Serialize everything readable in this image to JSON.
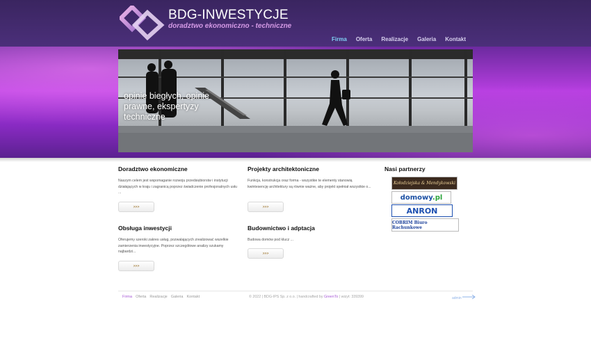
{
  "header": {
    "title": "BDG-INWESTYCJE",
    "subtitle": "doradztwo ekonomiczno - techniczne",
    "nav": [
      "Firma",
      "Oferta",
      "Realizacje",
      "Galeria",
      "Kontakt"
    ]
  },
  "hero": {
    "caption": "opinie biegłych, opinie prawne, ekspertyzy techniczne"
  },
  "sections": [
    {
      "title": "Doradztwo ekonomiczne",
      "text": "Naszym celem jest wspomaganie rozwoju przedsiębiorstw i instytucji działających w kraju i zagranicą poprzez świadczenie profesjonalnych usłu ...",
      "button": ">>>"
    },
    {
      "title": "Projekty architektoniczne",
      "text": "Funkcja, konstrukcja oraz forma - wszystkie te elementy stanowią kwintesencję architektury są równie ważne, aby projekt spełniał wszystkie o...",
      "button": ">>>"
    },
    {
      "title": "Obsługa inwestycji",
      "text": "Oferujemy szeroki zakres usług, pozwalających zrealizować wszelkie zamierzenia inwestycyjne. Poprzez szczegółowe analizy szukamy najbardzi...",
      "button": ">>>"
    },
    {
      "title": "Budownictwo i adptacja",
      "text": "Budowa domów pod klucz ...",
      "button": ">>>"
    }
  ],
  "partners": {
    "title": "Nasi partnerzy",
    "logos": [
      {
        "text": "Kołodziejska & Mendykowski"
      },
      {
        "text_main": "domowy",
        "text_accent": ".pl"
      },
      {
        "text": "ANRON"
      },
      {
        "text": "COBRIM  Biuro Rachunkowe"
      }
    ]
  },
  "footer": {
    "nav": [
      "Firma",
      "Oferta",
      "Realizacje",
      "Galeria",
      "Kontakt"
    ],
    "copyright_prefix": "© 2022 | BDG-IPS Sp. z o.o. | handcrafted by",
    "crafter": "GreenTo",
    "visits": "| wizyt: 339399",
    "admin": "admin"
  },
  "colors": {
    "header_bg": "#3a2560",
    "nav_active": "#7fd2f5",
    "subtitle": "#d59ae6",
    "band": "#b63ee0"
  }
}
